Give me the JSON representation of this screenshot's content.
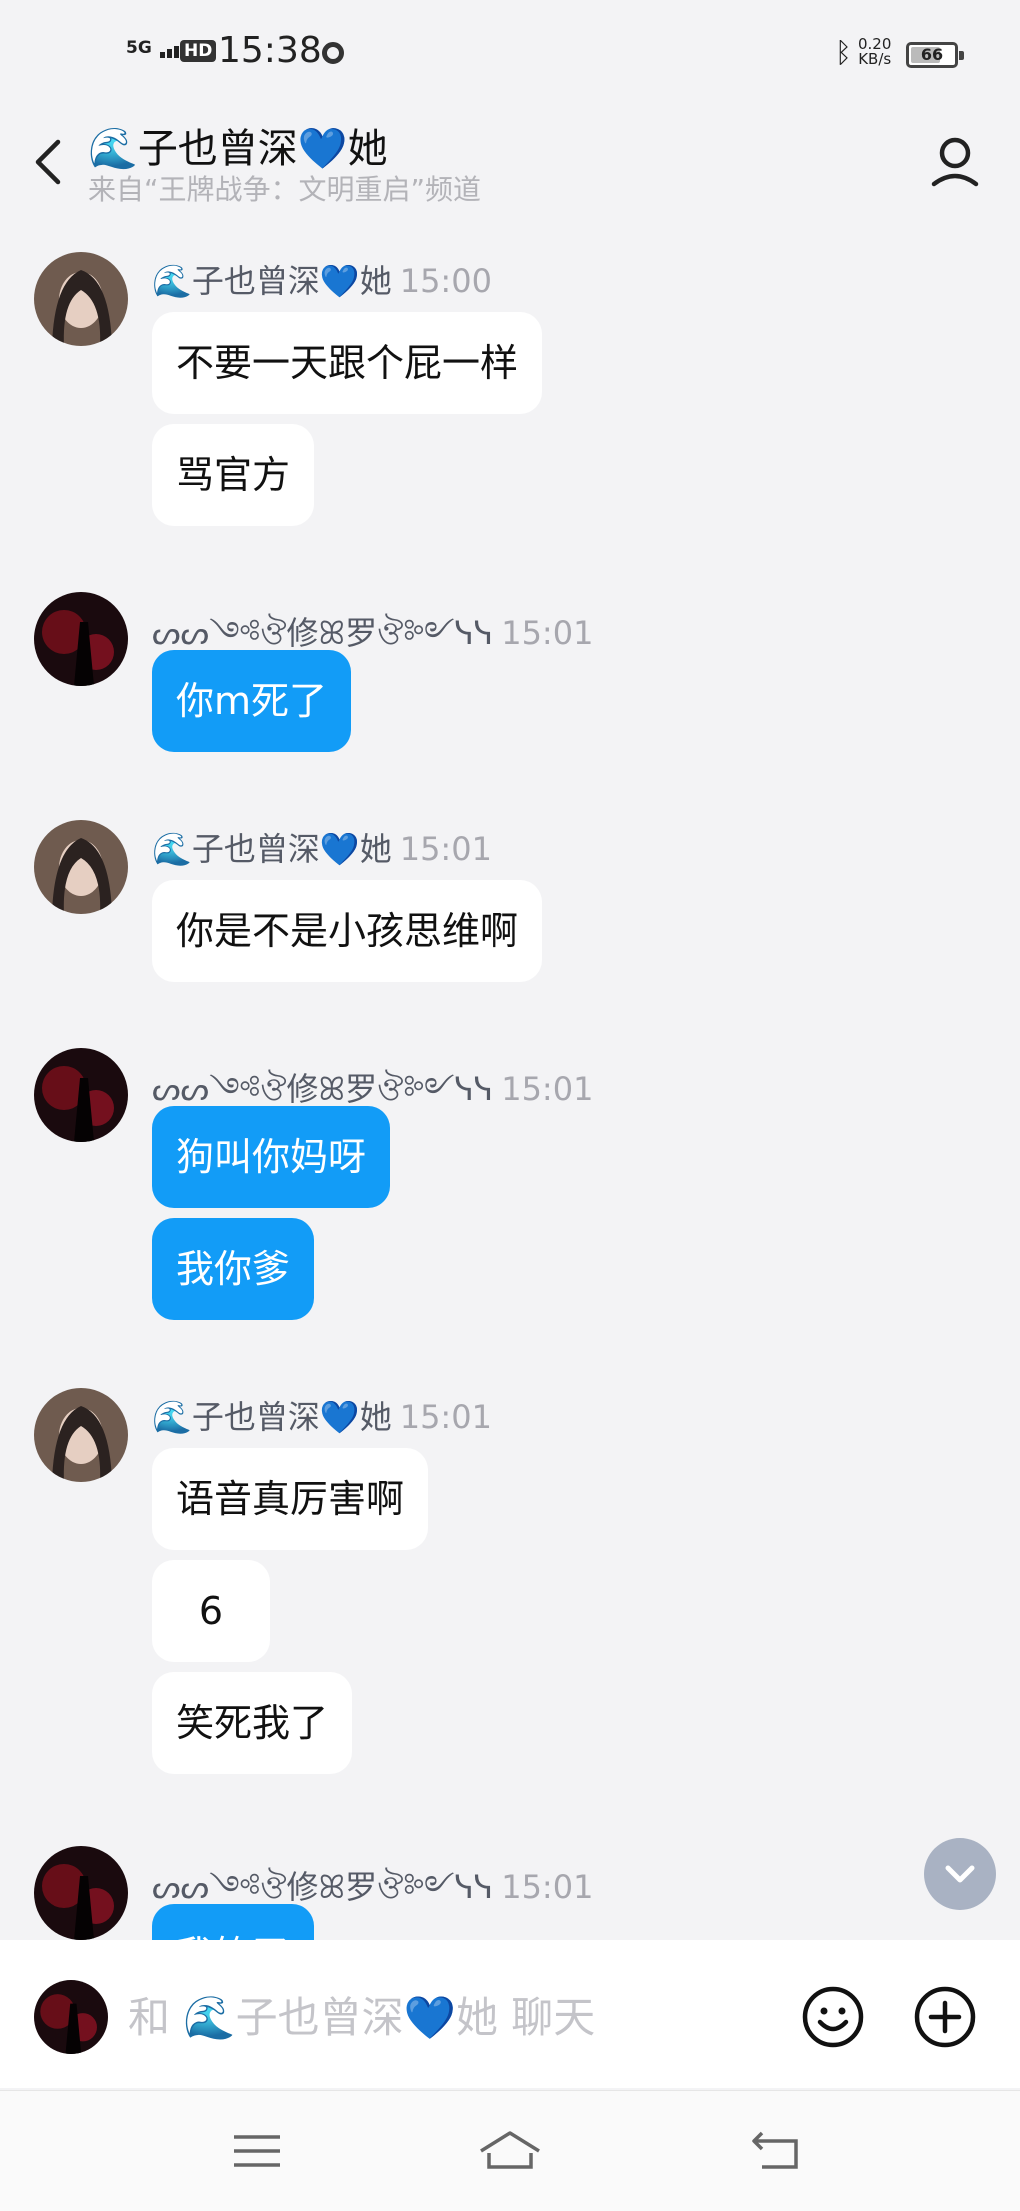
{
  "status_bar": {
    "network": "5G",
    "hd": "HD",
    "time": "15:38",
    "speed_value": "0.20",
    "speed_unit": "KB/s",
    "battery": "66"
  },
  "header": {
    "title_emoji": "🌊",
    "title": "子也曾深💙她",
    "subtitle": "来自“王牌战争：文明重启”频道"
  },
  "messages": [
    {
      "sender": "🌊子也曾深💙她",
      "time": "15:00",
      "side": "white",
      "bubbles": [
        "不要一天跟个屁一样",
        "骂官方"
      ]
    },
    {
      "sender": "ᔕᔕ༺ঔ修ꕤ罗ঔ༻ᓭᓭ",
      "time": "15:01",
      "side": "blue",
      "bubbles": [
        "你m死了"
      ]
    },
    {
      "sender": "🌊子也曾深💙她",
      "time": "15:01",
      "side": "white",
      "bubbles": [
        "你是不是小孩思维啊"
      ]
    },
    {
      "sender": "ᔕᔕ༺ঔ修ꕤ罗ঔ༻ᓭᓭ",
      "time": "15:01",
      "side": "blue",
      "bubbles": [
        "狗叫你妈呀",
        "我你爹"
      ]
    },
    {
      "sender": "🌊子也曾深💙她",
      "time": "15:01",
      "side": "white",
      "bubbles": [
        "语音真厉害啊",
        "6",
        "笑死我了"
      ]
    },
    {
      "sender": "ᔕᔕ༺ঔ修ꕤ罗ঔ༻ᓭᓭ",
      "time": "15:01",
      "side": "blue",
      "bubbles": [
        "我笑了"
      ]
    }
  ],
  "input": {
    "placeholder": "和 🌊子也曾深💙她 聊天"
  },
  "colors": {
    "blue_bubble": "#129cf7",
    "background": "#f3f3f5"
  }
}
